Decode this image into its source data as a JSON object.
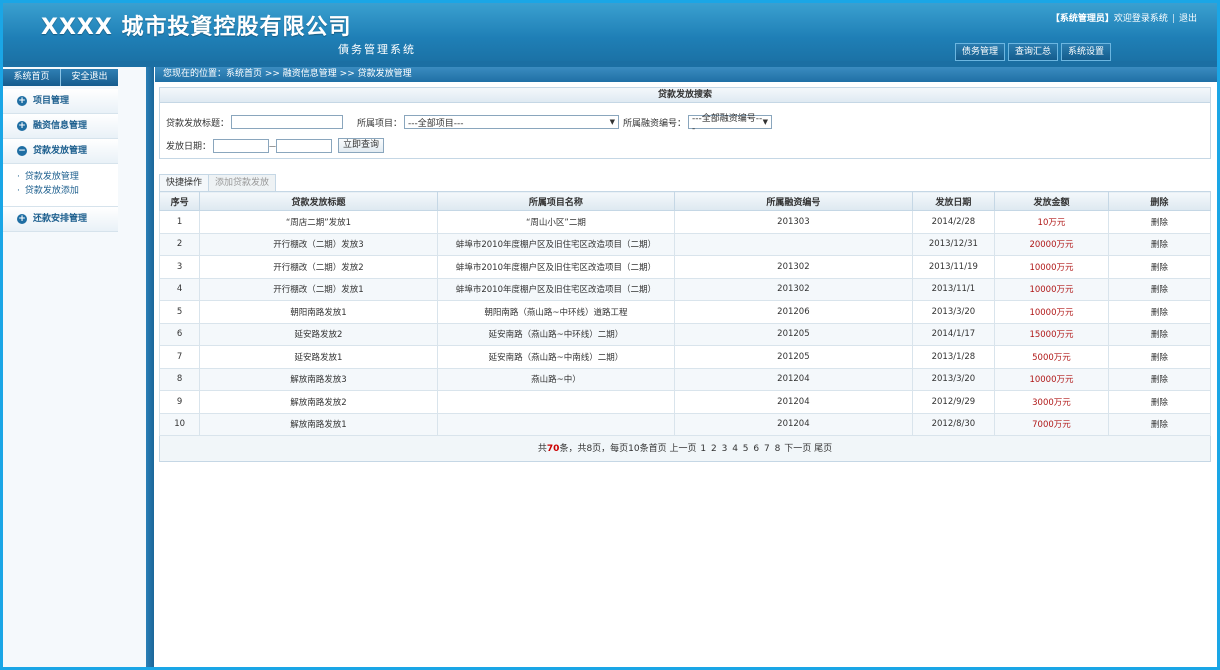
{
  "header": {
    "title": "XXXX 城市投資控股有限公司",
    "subtitle": "債务管理系统",
    "role": "【系统管理员】",
    "welcome": "欢迎登录系统",
    "separator": "|",
    "logout": "退出",
    "nav": [
      "债务管理",
      "查询汇总",
      "系统设置"
    ]
  },
  "sidebar": {
    "tabs": [
      "系统首页",
      "安全退出"
    ],
    "menu": [
      {
        "label": "项目管理",
        "icon": "plus-icon"
      },
      {
        "label": "融资信息管理",
        "icon": "plus-icon"
      },
      {
        "label": "贷款发放管理",
        "icon": "minus-icon"
      },
      {
        "label": "还款安排管理",
        "icon": "plus-icon"
      }
    ],
    "submenu": [
      "贷款发放管理",
      "贷款发放添加"
    ]
  },
  "breadcrumb": "您现在的位置：系统首页 >> 融资信息管理 >> 贷款发放管理",
  "search": {
    "panel_title": "贷款发放搜索",
    "title_label": "贷款发放标题：",
    "title_value": "",
    "project_label": "所属项目：",
    "project_value": "---全部项目---",
    "finance_label": "所属融资编号：",
    "finance_value": "---全部融资编号---",
    "date_label": "发放日期：",
    "date_sep": "—",
    "date_from": "",
    "date_to": "",
    "query_button": "立即查询"
  },
  "ops": {
    "label": "快捷操作",
    "add_button": "添加贷款发放"
  },
  "table": {
    "headers": [
      "序号",
      "贷款发放标题",
      "所属项目名称",
      "所属融资编号",
      "发放日期",
      "发放金额",
      "删除"
    ],
    "rows": [
      [
        "1",
        "“周店二期”发放1",
        "“周山小区”二期",
        "201303",
        "2014/2/28",
        "10万元",
        "删除"
      ],
      [
        "2",
        "开行棚改（二期）发放3",
        "蚌埠市2010年度棚户区及旧住宅区改造项目（二期）",
        "",
        "2013/12/31",
        "20000万元",
        "删除"
      ],
      [
        "3",
        "开行棚改（二期）发放2",
        "蚌埠市2010年度棚户区及旧住宅区改造项目（二期）",
        "201302",
        "2013/11/19",
        "10000万元",
        "删除"
      ],
      [
        "4",
        "开行棚改（二期）发放1",
        "蚌埠市2010年度棚户区及旧住宅区改造项目（二期）",
        "201302",
        "2013/11/1",
        "10000万元",
        "删除"
      ],
      [
        "5",
        "朝阳南路发放1",
        "朝阳南路（燕山路~中环线）道路工程",
        "201206",
        "2013/3/20",
        "10000万元",
        "删除"
      ],
      [
        "6",
        "延安路发放2",
        "延安南路（燕山路~中环线）二期）",
        "201205",
        "2014/1/17",
        "15000万元",
        "删除"
      ],
      [
        "7",
        "延安路发放1",
        "延安南路（燕山路~中南线）二期）",
        "201205",
        "2013/1/28",
        "5000万元",
        "删除"
      ],
      [
        "8",
        "解放南路发放3",
        "燕山路~中）",
        "201204",
        "2013/3/20",
        "10000万元",
        "删除"
      ],
      [
        "9",
        "解放南路发放2",
        "",
        "201204",
        "2012/9/29",
        "3000万元",
        "删除"
      ],
      [
        "10",
        "解放南路发放1",
        "",
        "201204",
        "2012/8/30",
        "7000万元",
        "删除"
      ]
    ]
  },
  "pager": {
    "prefix": "共",
    "total": "70",
    "mid": "条，共8页，每页10条首页 上一页",
    "pages": [
      "1",
      "2",
      "3",
      "4",
      "5",
      "6",
      "7",
      "8"
    ],
    "suffix": "下一页 尾页"
  },
  "colors": {
    "header_blue": "#1f7fb6",
    "frame_border": "#1aa6e6",
    "amount_red": "#b01818"
  }
}
